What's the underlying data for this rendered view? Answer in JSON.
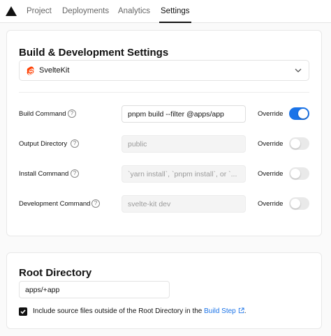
{
  "nav": {
    "tabs": [
      {
        "label": "Project"
      },
      {
        "label": "Deployments"
      },
      {
        "label": "Analytics"
      },
      {
        "label": "Settings",
        "active": true
      }
    ]
  },
  "build": {
    "title": "Build & Development Settings",
    "framework": {
      "label": "SvelteKit",
      "icon": "svelte-icon"
    },
    "override_label": "Override",
    "rows": [
      {
        "label": "Build Command",
        "value": "pnpm build --filter @apps/app",
        "override": true
      },
      {
        "label": "Output Directory",
        "placeholder": "public",
        "override": false
      },
      {
        "label": "Install Command",
        "placeholder": "`yarn install`, `pnpm install`, or `...",
        "override": false
      },
      {
        "label": "Development Command",
        "placeholder": "svelte-kit dev",
        "override": false
      }
    ]
  },
  "root": {
    "title": "Root Directory",
    "value": "apps/+app",
    "checkbox": {
      "checked": true,
      "text_before": "Include source files outside of the Root Directory in the ",
      "link": "Build Step",
      "text_after": "."
    }
  },
  "colors": {
    "accent": "#1a73e8",
    "toggle_off": "#e9e9e9",
    "svelte": "#ff3e00"
  }
}
